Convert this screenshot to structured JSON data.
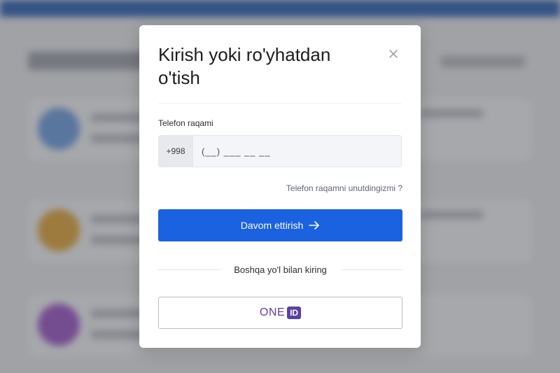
{
  "modal": {
    "title": "Kirish yoki ro'yhatdan o'tish",
    "close_icon": "close-icon"
  },
  "phone": {
    "label": "Telefon raqami",
    "prefix": "+998",
    "placeholder": "(__) ___ __ __"
  },
  "forgot_link": "Telefon raqamni unutdingizmi ?",
  "continue_button": {
    "label": "Davom ettirish",
    "icon": "arrow-right-icon"
  },
  "alt_login": {
    "divider_text": "Boshqa yo'l bilan kiring",
    "oneid_word": "ONE",
    "oneid_badge": "ID"
  },
  "colors": {
    "primary": "#1b62e0",
    "oneid": "#5b3fa8",
    "topbar": "#2f63b4"
  }
}
